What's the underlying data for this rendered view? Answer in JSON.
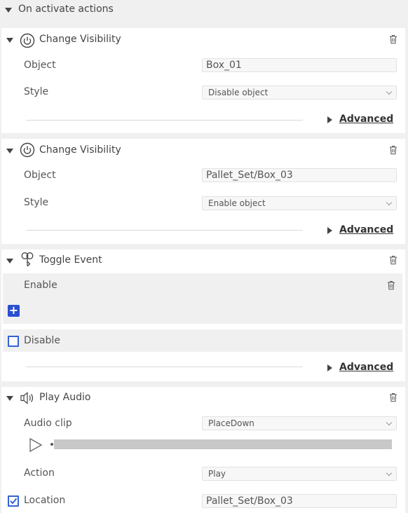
{
  "section": {
    "title": "On activate actions"
  },
  "cards": [
    {
      "title": "Change Visibility",
      "icon": "power-icon",
      "object_label": "Object",
      "object_value": "Box_01",
      "style_label": "Style",
      "style_value": "Disable object",
      "advanced_label": "Advanced"
    },
    {
      "title": "Change Visibility",
      "icon": "power-icon",
      "object_label": "Object",
      "object_value": "Pallet_Set/Box_03",
      "style_label": "Style",
      "style_value": "Enable object",
      "advanced_label": "Advanced"
    },
    {
      "title": "Toggle Event",
      "icon": "toggle-event-icon",
      "enable_label": "Enable",
      "add_label": "+",
      "disable_label": "Disable",
      "disable_checked": false,
      "advanced_label": "Advanced"
    },
    {
      "title": "Play Audio",
      "icon": "speaker-icon",
      "clip_label": "Audio clip",
      "clip_value": "PlaceDown",
      "action_label": "Action",
      "action_value": "Play",
      "location_label": "Location",
      "location_checked": true,
      "location_value": "Pallet_Set/Box_03"
    }
  ],
  "colors": {
    "background": "#f0f0f0",
    "card": "#ffffff",
    "accent": "#2a4fd0",
    "checkbox": "#3561d8"
  }
}
